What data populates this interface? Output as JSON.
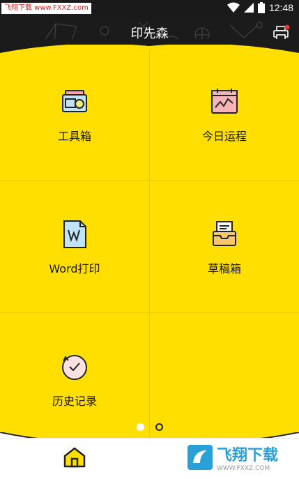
{
  "status": {
    "time": "12:48",
    "watermark": "飞翔下载 www.FXXZ.com"
  },
  "header": {
    "title": "印先森",
    "printer_icon": "printer-icon"
  },
  "grid": {
    "items": [
      {
        "label": "工具箱",
        "icon": "toolbox-icon"
      },
      {
        "label": "今日运程",
        "icon": "calendar-chart-icon"
      },
      {
        "label": "Word打印",
        "icon": "word-document-icon"
      },
      {
        "label": "草稿箱",
        "icon": "drafts-tray-icon"
      },
      {
        "label": "历史记录",
        "icon": "history-clock-icon"
      }
    ]
  },
  "pager": {
    "count": 2,
    "active": 0
  },
  "bottom": {
    "home_icon": "home-icon",
    "logo_main": "飞翔下载",
    "logo_sub": "WWW.FXXZ.COM"
  },
  "colors": {
    "accent": "#ffdf00",
    "dark": "#1b1b1b",
    "badge": "#e53935"
  }
}
